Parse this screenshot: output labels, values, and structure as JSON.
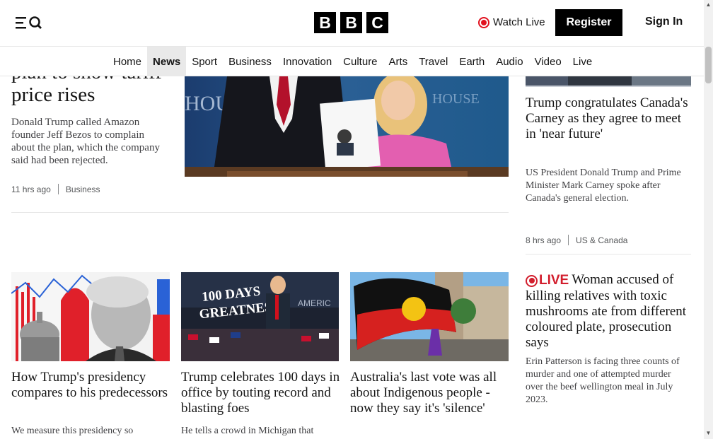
{
  "header": {
    "logo_letters": [
      "B",
      "B",
      "C"
    ],
    "watch_live": "Watch Live",
    "register": "Register",
    "sign_in": "Sign In",
    "icons": {
      "menu": "menu-icon",
      "search": "search-icon",
      "live": "live-dot-icon"
    }
  },
  "nav": {
    "items": [
      {
        "label": "Home",
        "active": false
      },
      {
        "label": "News",
        "active": true
      },
      {
        "label": "Sport",
        "active": false
      },
      {
        "label": "Business",
        "active": false
      },
      {
        "label": "Innovation",
        "active": false
      },
      {
        "label": "Culture",
        "active": false
      },
      {
        "label": "Arts",
        "active": false
      },
      {
        "label": "Travel",
        "active": false
      },
      {
        "label": "Earth",
        "active": false
      },
      {
        "label": "Audio",
        "active": false
      },
      {
        "label": "Video",
        "active": false
      },
      {
        "label": "Live",
        "active": false
      }
    ]
  },
  "lead": {
    "title": "plan to show tariff price rises",
    "description": "Donald Trump called Amazon founder Jeff Bezos to complain about the plan, which the company said had been rejected.",
    "time": "11 hrs ago",
    "category": "Business",
    "image_alt": "White House press briefing with press secretary holding a printed article"
  },
  "side_story": {
    "title": "Trump congratulates Canada's Carney as they agree to meet in 'near future'",
    "description": "US President Donald Trump and Prime Minister Mark Carney spoke after Canada's general election.",
    "time": "8 hrs ago",
    "category": "US & Canada"
  },
  "cards": [
    {
      "title": "How Trump's presidency compares to his predecessors",
      "description": "We measure this presidency so",
      "image_alt": "Trump portrait with Capitol and charts"
    },
    {
      "title": "Trump celebrates 100 days in office by touting record and blasting foes",
      "description": "He tells a crowd in Michigan that",
      "image_alt": "100 Days of Greatness rally",
      "image_sign": "100 DAYS\nof\nGREATNESS"
    },
    {
      "title": "Australia's last vote was all about Indigenous people - now they say it's 'silence'",
      "description": "",
      "image_alt": "Aboriginal flag being waved in a city street"
    }
  ],
  "live_story": {
    "badge": "LIVE",
    "title": "Woman accused of killing relatives with toxic mushrooms ate from different coloured plate, prosecution says",
    "description": "Erin Patterson is facing three counts of murder and one of attempted murder over the beef wellington meal in July 2023."
  },
  "colors": {
    "live_red": "#d21e2d",
    "text": "#141414",
    "nav_active_bg": "#e9e9e9"
  }
}
